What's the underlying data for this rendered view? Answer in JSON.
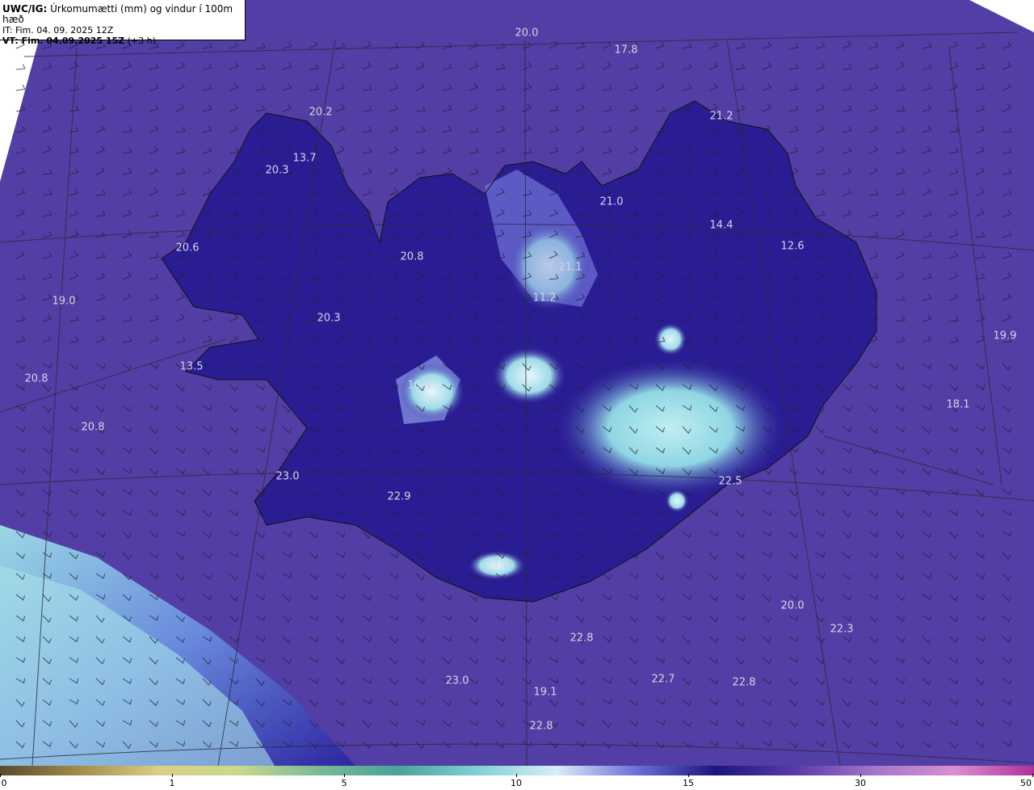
{
  "header": {
    "model": "UWC/IG:",
    "title_text": "Úrkomumætti (mm) og vindur í 100m hæð",
    "init_time": "IT: Fim. 04. 09. 2025 12Z",
    "valid_label": "VT: Fim. 04.09.2025 15Z",
    "valid_offset": "(+3 h)"
  },
  "values": [
    {
      "id": "v1",
      "text": "20.0"
    },
    {
      "id": "v2",
      "text": "17.8"
    },
    {
      "id": "v3",
      "text": "20.2"
    },
    {
      "id": "v4",
      "text": "21.2"
    },
    {
      "id": "v5",
      "text": "13.7"
    },
    {
      "id": "v6",
      "text": "20.3"
    },
    {
      "id": "v7",
      "text": "21.0"
    },
    {
      "id": "v8",
      "text": "14.4"
    },
    {
      "id": "v9",
      "text": "20.6"
    },
    {
      "id": "v10",
      "text": "12.6"
    },
    {
      "id": "v11",
      "text": "20.8"
    },
    {
      "id": "v12",
      "text": "21.1"
    },
    {
      "id": "v13",
      "text": "19.0"
    },
    {
      "id": "v14",
      "text": "11.2"
    },
    {
      "id": "v15",
      "text": "20.3"
    },
    {
      "id": "v16",
      "text": "19.9"
    },
    {
      "id": "v17",
      "text": "13.5"
    },
    {
      "id": "v18",
      "text": "20.8"
    },
    {
      "id": "v19",
      "text": "10.4"
    },
    {
      "id": "v20",
      "text": "18.1"
    },
    {
      "id": "v21",
      "text": "20.8"
    },
    {
      "id": "v22",
      "text": "23.0"
    },
    {
      "id": "v23",
      "text": "22.5"
    },
    {
      "id": "v24",
      "text": "22.9"
    },
    {
      "id": "v25",
      "text": "11.2"
    },
    {
      "id": "v26",
      "text": "20.0"
    },
    {
      "id": "v27",
      "text": "22.3"
    },
    {
      "id": "v28",
      "text": "22.8"
    },
    {
      "id": "v29",
      "text": "23.0"
    },
    {
      "id": "v30",
      "text": "22.7"
    },
    {
      "id": "v31",
      "text": "22.8"
    },
    {
      "id": "v32",
      "text": "19.1"
    },
    {
      "id": "v33",
      "text": "22.8"
    }
  ],
  "colorbar": {
    "ticks": [
      "0",
      "1",
      "5",
      "10",
      "15",
      "30",
      "50"
    ],
    "stops": [
      "#5a4a2e",
      "#a58c4a",
      "#d9cf86",
      "#c9d98e",
      "#7ab996",
      "#4aa39a",
      "#7fd0d6",
      "#d8eef5",
      "#6c6fd8",
      "#1c1480",
      "#5b3aa7",
      "#a377c9",
      "#d98fd0",
      "#b02f9a"
    ]
  },
  "colors": {
    "sea": "#4d3aa0",
    "land_outline": "#111111",
    "grid": "#2a2a3a",
    "barb": "#222233"
  }
}
